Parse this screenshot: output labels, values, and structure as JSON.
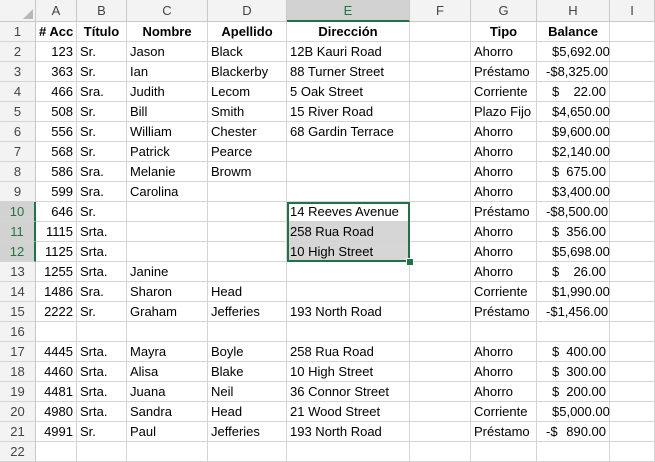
{
  "columns": [
    "A",
    "B",
    "C",
    "D",
    "E",
    "F",
    "G",
    "H",
    "I"
  ],
  "selected_column": "E",
  "selected_rows": [
    10,
    11,
    12
  ],
  "row_numbers": [
    "1",
    "2",
    "3",
    "4",
    "5",
    "6",
    "7",
    "8",
    "9",
    "10",
    "11",
    "12",
    "13",
    "14",
    "15",
    "16",
    "17",
    "18",
    "19",
    "20",
    "21",
    "22"
  ],
  "headers": {
    "acc": "# Acc",
    "titulo": "Título",
    "nombre": "Nombre",
    "apellido": "Apellido",
    "direccion": "Dirección",
    "tipo": "Tipo",
    "balance": "Balance"
  },
  "rows": [
    {
      "acc": "123",
      "titulo": "Sr.",
      "nombre": "Jason",
      "apellido": "Black",
      "direccion": "12B Kauri Road",
      "tipo": "Ahorro",
      "sign": "",
      "amount": "5,692.00"
    },
    {
      "acc": "363",
      "titulo": "Sr.",
      "nombre": "Ian",
      "apellido": "Blackerby",
      "direccion": "88 Turner Street",
      "tipo": "Préstamo",
      "sign": "-",
      "amount": "8,325.00"
    },
    {
      "acc": "466",
      "titulo": "Sra.",
      "nombre": "Judith",
      "apellido": "Lecom",
      "direccion": "5 Oak Street",
      "tipo": "Corriente",
      "sign": "",
      "amount": "22.00"
    },
    {
      "acc": "508",
      "titulo": "Sr.",
      "nombre": "Bill",
      "apellido": "Smith",
      "direccion": "15 River Road",
      "tipo": "Plazo Fijo",
      "sign": "",
      "amount": "4,650.00"
    },
    {
      "acc": "556",
      "titulo": "Sr.",
      "nombre": "William",
      "apellido": "Chester",
      "direccion": "68 Gardin Terrace",
      "tipo": "Ahorro",
      "sign": "",
      "amount": "9,600.00"
    },
    {
      "acc": "568",
      "titulo": "Sr.",
      "nombre": "Patrick",
      "apellido": "Pearce",
      "direccion": "",
      "tipo": "Ahorro",
      "sign": "",
      "amount": "2,140.00"
    },
    {
      "acc": "586",
      "titulo": "Sra.",
      "nombre": "Melanie",
      "apellido": "Browm",
      "direccion": "",
      "tipo": "Ahorro",
      "sign": "",
      "amount": "675.00"
    },
    {
      "acc": "599",
      "titulo": "Sra.",
      "nombre": "Carolina",
      "apellido": "",
      "direccion": "",
      "tipo": "Ahorro",
      "sign": "",
      "amount": "3,400.00"
    },
    {
      "acc": "646",
      "titulo": "Sr.",
      "nombre": "",
      "apellido": "",
      "direccion": "14 Reeves Avenue",
      "tipo": "Préstamo",
      "sign": "-",
      "amount": "8,500.00"
    },
    {
      "acc": "1115",
      "titulo": "Srta.",
      "nombre": "",
      "apellido": "",
      "direccion": "258 Rua Road",
      "tipo": "Ahorro",
      "sign": "",
      "amount": "356.00"
    },
    {
      "acc": "1125",
      "titulo": "Srta.",
      "nombre": "",
      "apellido": "",
      "direccion": "10 High Street",
      "tipo": "Ahorro",
      "sign": "",
      "amount": "5,698.00"
    },
    {
      "acc": "1255",
      "titulo": "Srta.",
      "nombre": "Janine",
      "apellido": "",
      "direccion": "",
      "tipo": "Ahorro",
      "sign": "",
      "amount": "26.00"
    },
    {
      "acc": "1486",
      "titulo": "Sra.",
      "nombre": "Sharon",
      "apellido": "Head",
      "direccion": "",
      "tipo": "Corriente",
      "sign": "",
      "amount": "1,990.00"
    },
    {
      "acc": "2222",
      "titulo": "Sr.",
      "nombre": "Graham",
      "apellido": "Jefferies",
      "direccion": "193 North Road",
      "tipo": "Préstamo",
      "sign": "-",
      "amount": "1,456.00"
    },
    {
      "acc": "",
      "titulo": "",
      "nombre": "",
      "apellido": "",
      "direccion": "",
      "tipo": "",
      "sign": "",
      "amount": ""
    },
    {
      "acc": "4445",
      "titulo": "Srta.",
      "nombre": "Mayra",
      "apellido": "Boyle",
      "direccion": "258 Rua Road",
      "tipo": "Ahorro",
      "sign": "",
      "amount": "400.00"
    },
    {
      "acc": "4460",
      "titulo": "Srta.",
      "nombre": "Alisa",
      "apellido": "Blake",
      "direccion": "10 High Street",
      "tipo": "Ahorro",
      "sign": "",
      "amount": "300.00"
    },
    {
      "acc": "4481",
      "titulo": "Srta.",
      "nombre": "Juana",
      "apellido": "Neil",
      "direccion": "36 Connor Street",
      "tipo": "Ahorro",
      "sign": "",
      "amount": "200.00"
    },
    {
      "acc": "4980",
      "titulo": "Srta.",
      "nombre": "Sandra",
      "apellido": "Head",
      "direccion": "21 Wood Street",
      "tipo": "Corriente",
      "sign": "",
      "amount": "5,000.00"
    },
    {
      "acc": "4991",
      "titulo": "Sr.",
      "nombre": "Paul",
      "apellido": "Jefferies",
      "direccion": "193 North Road",
      "tipo": "Préstamo",
      "sign": "-",
      "amount": "890.00"
    }
  ],
  "currency_symbol": "$",
  "colors": {
    "accent": "#217346",
    "selection_fill": "#d6d6d6",
    "header_bg": "#f3f3f3",
    "gridline": "#d4d4d4"
  }
}
